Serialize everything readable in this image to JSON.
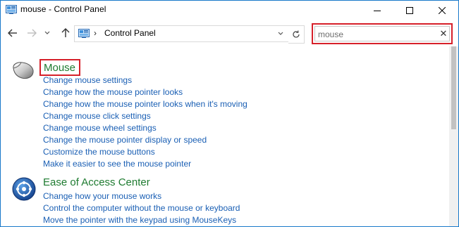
{
  "window": {
    "title": "mouse - Control Panel",
    "accent_color": "#1979ca"
  },
  "nav": {
    "back_icon": "arrow-left-icon",
    "forward_icon": "arrow-right-icon",
    "recent_icon": "chevron-down-icon",
    "up_icon": "arrow-up-icon"
  },
  "address": {
    "separator": "›",
    "location": "Control Panel"
  },
  "search": {
    "value": "mouse",
    "clear_glyph": "✕",
    "highlight_color": "#d6202a"
  },
  "results": [
    {
      "title": "Mouse",
      "icon": "mouse-icon",
      "links": [
        "Change mouse settings",
        "Change how the mouse pointer looks",
        "Change how the mouse pointer looks when it's moving",
        "Change mouse click settings",
        "Change mouse wheel settings",
        "Change the mouse pointer display or speed",
        "Customize the mouse buttons",
        "Make it easier to see the mouse pointer"
      ]
    },
    {
      "title": "Ease of Access Center",
      "icon": "ease-of-access-icon",
      "links": [
        "Change how your mouse works",
        "Control the computer without the mouse or keyboard",
        "Move the pointer with the keypad using MouseKeys"
      ]
    }
  ],
  "colors": {
    "heading": "#1e7b30",
    "link": "#1a5fb4"
  }
}
